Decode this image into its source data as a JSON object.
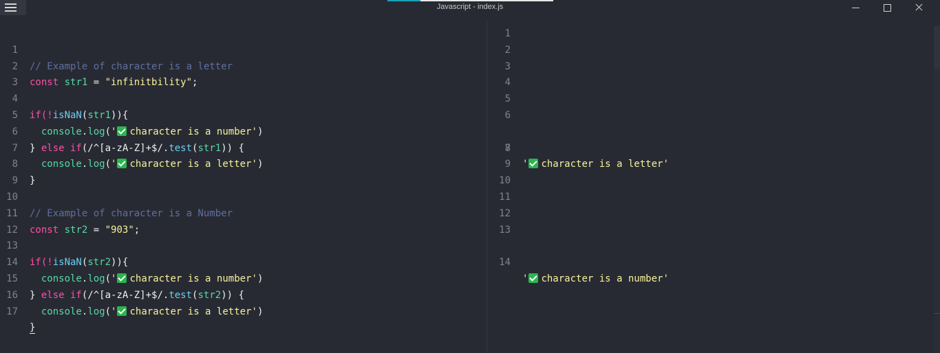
{
  "window": {
    "title": "Javascript - index.js",
    "progress_percent": 20,
    "colors": {
      "background": "#282a33",
      "progress": "#19a3b6",
      "checkmark": "#2ab64f"
    },
    "icons": [
      "menu-icon",
      "minimize-icon",
      "maximize-icon",
      "close-icon",
      "check-mark-emoji-icon"
    ]
  },
  "editor": {
    "line_numbers": [
      "1",
      "2",
      "3",
      "4",
      "5",
      "6",
      "7",
      "8",
      "9",
      "10",
      "11",
      "12",
      "13",
      "14",
      "15",
      "16",
      "17"
    ],
    "lines": [
      {
        "comment": "// Example of character is a letter"
      },
      {
        "kw": "const",
        "sp1": " ",
        "var": "str1",
        "eq": " = ",
        "str": "\"infinitbility\"",
        "semi": ";"
      },
      {},
      {
        "kw": "if",
        "p1": "(!",
        "fn": "isNaN",
        "p2": "(",
        "var": "str1",
        "p3": ")){"
      },
      {
        "indent": "  ",
        "obj": "console",
        "dot": ".",
        "fn": "log",
        "p1": "(",
        "q1": "'",
        "text": "character is a number",
        "q2": "'",
        "p2": ")"
      },
      {
        "p0": "} ",
        "kw": "else if",
        "p1": "(/^[a-zA-Z]+$/.",
        "fn": "test",
        "p2": "(",
        "var": "str1",
        "p3": ")) {"
      },
      {
        "indent": "  ",
        "obj": "console",
        "dot": ".",
        "fn": "log",
        "p1": "(",
        "q1": "'",
        "text": "character is a letter",
        "q2": "'",
        "p2": ")"
      },
      {
        "p0": "}"
      },
      {},
      {
        "comment": "// Example of character is a Number"
      },
      {
        "kw": "const",
        "sp1": " ",
        "var": "str2",
        "eq": " = ",
        "str": "\"903\"",
        "semi": ";"
      },
      {},
      {
        "kw": "if",
        "p1": "(!",
        "fn": "isNaN",
        "p2": "(",
        "var": "str2",
        "p3": ")){"
      },
      {
        "indent": "  ",
        "obj": "console",
        "dot": ".",
        "fn": "log",
        "p1": "(",
        "q1": "'",
        "text": "character is a number",
        "q2": "'",
        "p2": ")"
      },
      {
        "p0": "} ",
        "kw": "else if",
        "p1": "(/^[a-zA-Z]+$/.",
        "fn": "test",
        "p2": "(",
        "var": "str2",
        "p3": ")) {"
      },
      {
        "indent": "  ",
        "obj": "console",
        "dot": ".",
        "fn": "log",
        "p1": "(",
        "q1": "'",
        "text": "character is a letter",
        "q2": "'",
        "p2": ")"
      },
      {
        "p0": "}"
      }
    ]
  },
  "output": {
    "line_numbers": [
      "1",
      "2",
      "3",
      "4",
      "5",
      "6",
      "7",
      "8",
      "9",
      "10",
      "11",
      "12",
      "13",
      "14"
    ],
    "lines": [
      {},
      {},
      {},
      {},
      {},
      {},
      {
        "q1": "'",
        "text": "character is a letter",
        "q2": "'"
      },
      {},
      {},
      {},
      {},
      {},
      {},
      {
        "q1": "'",
        "text": "character is a number",
        "q2": "'"
      }
    ]
  }
}
